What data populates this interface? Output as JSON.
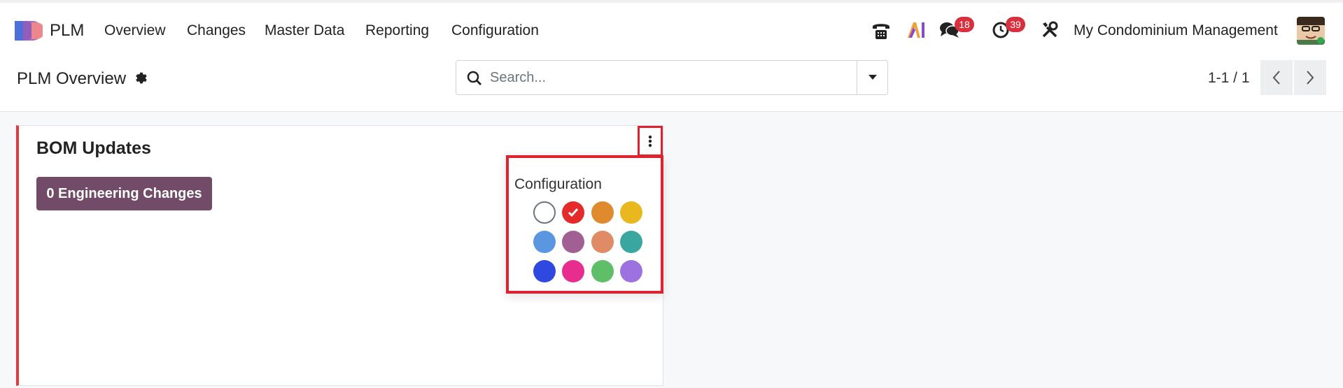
{
  "topbar": {
    "app_name": "PLM",
    "menu": [
      "Overview",
      "Changes",
      "Master Data",
      "Reporting",
      "Configuration"
    ],
    "icons": [
      "phone-icon",
      "ai-icon",
      "messages-icon",
      "activity-clock-icon",
      "tools-icon"
    ],
    "messages_badge": "18",
    "activities_badge": "39",
    "company": "My Condominium Management"
  },
  "controlbar": {
    "title": "PLM Overview",
    "search_placeholder": "Search...",
    "pager": "1-1 / 1"
  },
  "card": {
    "title": "BOM Updates",
    "button_label": "0 Engineering Changes",
    "accent_color": "#e03a3e"
  },
  "dropdown": {
    "title": "Configuration",
    "colors": [
      "#ffffff",
      "#e42a2a",
      "#e08a2e",
      "#e8b81e",
      "#5b97e0",
      "#a15f93",
      "#e08a66",
      "#3aa6a0",
      "#2f48e0",
      "#e72d8d",
      "#5fbf68",
      "#9d72e0"
    ],
    "selected_index": 1
  }
}
